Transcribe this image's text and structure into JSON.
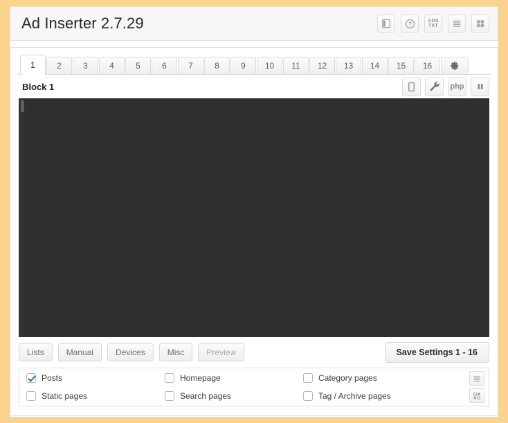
{
  "header": {
    "title": "Ad Inserter 2.7.29",
    "icons": [
      {
        "name": "book-icon",
        "label": ""
      },
      {
        "name": "help-icon",
        "label": "?"
      },
      {
        "name": "ads-txt-icon",
        "label_top": "ADS",
        "label_bottom": "TXT"
      },
      {
        "name": "list-view-icon",
        "label": ""
      },
      {
        "name": "grid-view-icon",
        "label": ""
      }
    ]
  },
  "tabs": {
    "items": [
      "1",
      "2",
      "3",
      "4",
      "5",
      "6",
      "7",
      "8",
      "9",
      "10",
      "11",
      "12",
      "13",
      "14",
      "15",
      "16"
    ],
    "active": "1",
    "settings_tab": "settings-gear"
  },
  "block": {
    "title": "Block 1",
    "icons": [
      {
        "name": "device-icon"
      },
      {
        "name": "wrench-icon"
      },
      {
        "name": "php-icon",
        "label": "php"
      },
      {
        "name": "pause-icon"
      }
    ]
  },
  "editor": {
    "content": "",
    "background": "#2f2f2f"
  },
  "actions": {
    "buttons": [
      "Lists",
      "Manual",
      "Devices",
      "Misc",
      "Preview"
    ],
    "save_label": "Save Settings 1 - 16"
  },
  "display_options": {
    "columns": [
      [
        {
          "label": "Posts",
          "checked": true
        },
        {
          "label": "Static pages",
          "checked": false
        }
      ],
      [
        {
          "label": "Homepage",
          "checked": false
        },
        {
          "label": "Search pages",
          "checked": false
        }
      ],
      [
        {
          "label": "Category pages",
          "checked": false
        },
        {
          "label": "Tag / Archive pages",
          "checked": false
        }
      ]
    ],
    "side_icons": [
      {
        "name": "lines-icon"
      },
      {
        "name": "qr-grid-icon"
      }
    ]
  },
  "colors": {
    "page_border": "#fbd38d",
    "accent": "#2271b1",
    "editor_bg": "#2f2f2f"
  }
}
